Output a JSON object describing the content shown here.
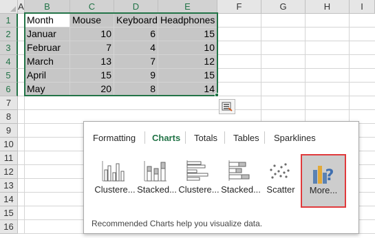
{
  "sheet": {
    "columns": [
      "A",
      "B",
      "C",
      "D",
      "E",
      "F",
      "G",
      "H",
      "I"
    ],
    "rows": [
      "1",
      "2",
      "3",
      "4",
      "5",
      "6",
      "7",
      "8",
      "9",
      "10",
      "11",
      "12",
      "13",
      "14",
      "15",
      "16"
    ],
    "table": {
      "headers": [
        "Month",
        "Mouse",
        "Keyboard",
        "Headphones"
      ],
      "data": [
        [
          "Januar",
          "10",
          "6",
          "15"
        ],
        [
          "Februar",
          "7",
          "4",
          "10"
        ],
        [
          "March",
          "13",
          "7",
          "12"
        ],
        [
          "April",
          "15",
          "9",
          "15"
        ],
        [
          "May",
          "20",
          "8",
          "14"
        ]
      ]
    }
  },
  "quick_analysis": {
    "tabs": [
      "Formatting",
      "Charts",
      "Totals",
      "Tables",
      "Sparklines"
    ],
    "active_tab": "Charts",
    "chart_options": [
      {
        "label": "Clustere...",
        "icon": "clustered-column-chart-icon"
      },
      {
        "label": "Stacked...",
        "icon": "stacked-column-chart-icon"
      },
      {
        "label": "Clustere...",
        "icon": "clustered-bar-chart-icon"
      },
      {
        "label": "Stacked...",
        "icon": "stacked-bar-chart-icon"
      },
      {
        "label": "Scatter",
        "icon": "scatter-chart-icon"
      }
    ],
    "more_option": {
      "label": "More...",
      "icon": "more-charts-icon"
    },
    "description": "Recommended Charts help you visualize data.",
    "highlight_color": "#e0393b"
  },
  "colors": {
    "accent": "#217346",
    "selection_fill": "#c6c6c6"
  }
}
